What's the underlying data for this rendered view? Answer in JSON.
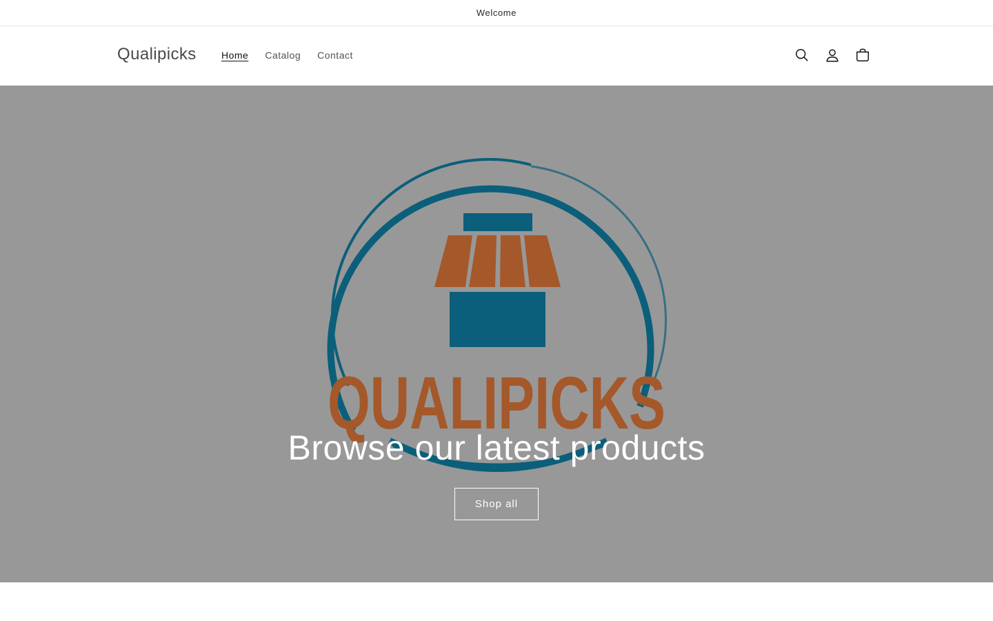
{
  "announcement": {
    "text": "Welcome"
  },
  "header": {
    "brand": "Qualipicks",
    "nav": [
      {
        "label": "Home",
        "active": true
      },
      {
        "label": "Catalog",
        "active": false
      },
      {
        "label": "Contact",
        "active": false
      }
    ],
    "icons": [
      "search-icon",
      "account-icon",
      "cart-icon"
    ]
  },
  "hero": {
    "logo_text": "QUALIPICKS",
    "title": "Browse our latest products",
    "button_label": "Shop all"
  },
  "colors": {
    "overlay": "#989898",
    "logo_teal": "#0b5f7a",
    "logo_orange": "#a5582a"
  }
}
